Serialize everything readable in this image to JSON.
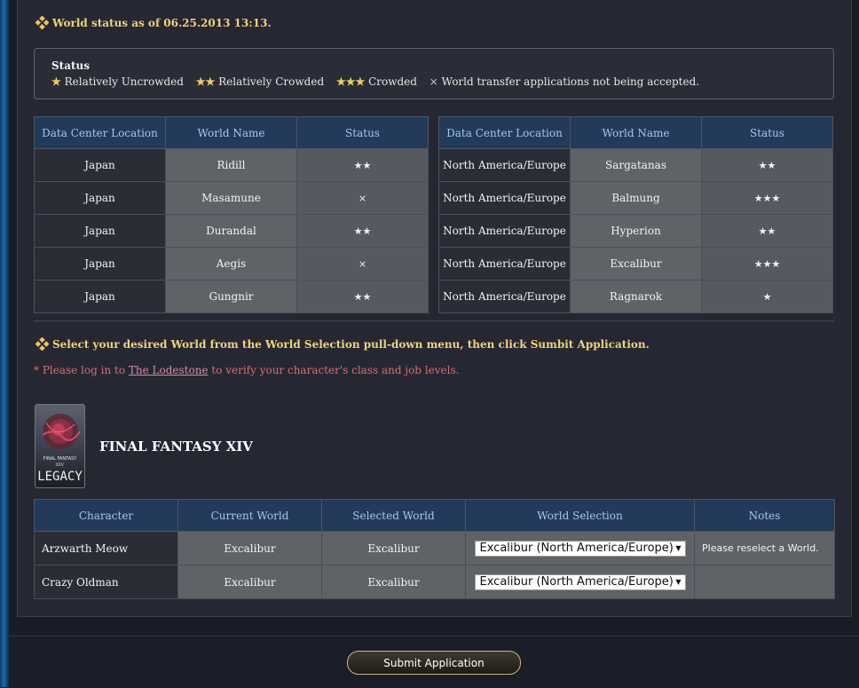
{
  "world_status": {
    "heading": "World status as of 06.25.2013 13:13.",
    "legend_title": "Status",
    "legend": [
      {
        "marker": "★",
        "label": "Relatively Uncrowded"
      },
      {
        "marker": "★★",
        "label": "Relatively Crowded"
      },
      {
        "marker": "★★★",
        "label": "Crowded"
      },
      {
        "marker": "×",
        "label": "World transfer applications not being accepted."
      }
    ]
  },
  "world_tables": {
    "headers": [
      "Data Center Location",
      "World Name",
      "Status"
    ],
    "japan": [
      {
        "location": "Japan",
        "world": "Ridill",
        "status": "★★"
      },
      {
        "location": "Japan",
        "world": "Masamune",
        "status": "×"
      },
      {
        "location": "Japan",
        "world": "Durandal",
        "status": "★★"
      },
      {
        "location": "Japan",
        "world": "Aegis",
        "status": "×"
      },
      {
        "location": "Japan",
        "world": "Gungnir",
        "status": "★★"
      }
    ],
    "na_eu": [
      {
        "location": "North America/Europe",
        "world": "Sargatanas",
        "status": "★★"
      },
      {
        "location": "North America/Europe",
        "world": "Balmung",
        "status": "★★★"
      },
      {
        "location": "North America/Europe",
        "world": "Hyperion",
        "status": "★★"
      },
      {
        "location": "North America/Europe",
        "world": "Excalibur",
        "status": "★★★"
      },
      {
        "location": "North America/Europe",
        "world": "Ragnarok",
        "status": "★"
      }
    ]
  },
  "instructions": {
    "heading": "Select your desired World from the World Selection pull-down menu, then click Sumbit Application.",
    "note_prefix": "* Please log in to ",
    "note_link": "The Lodestone",
    "note_suffix": " to verify your character's class and job levels."
  },
  "game": {
    "title": "FINAL FANTASY XIV",
    "logo_text_top": "FINAL FANTASY",
    "logo_text_xiv": "XIV",
    "logo_text_legacy": "LEGACY"
  },
  "characters": {
    "headers": [
      "Character",
      "Current World",
      "Selected World",
      "World Selection",
      "Notes"
    ],
    "rows": [
      {
        "name": "Arzwarth Meow",
        "current": "Excalibur",
        "selected": "Excalibur",
        "selection": "Excalibur (North America/Europe)",
        "note": "Please reselect a World."
      },
      {
        "name": "Crazy Oldman",
        "current": "Excalibur",
        "selected": "Excalibur",
        "selection": "Excalibur (North America/Europe)",
        "note": ""
      }
    ]
  },
  "submit_label": "Submit Application",
  "colors": {
    "accent_gold": "#f0d27a",
    "header_blue": "#243a5a",
    "warning_red": "#ff3b3b"
  },
  "icons": {
    "section_marker": "diamond-cluster-icon",
    "select_arrow": "chevron-down-icon"
  }
}
